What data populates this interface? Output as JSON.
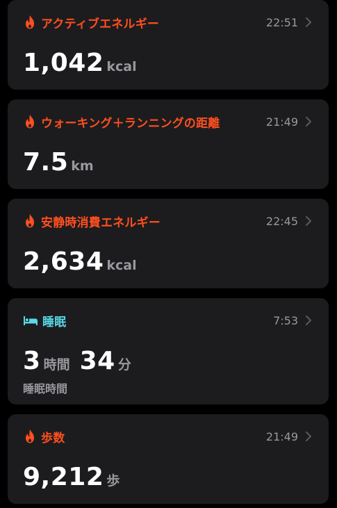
{
  "colors": {
    "accent_activity": "#ff4f1f",
    "accent_sleep": "#5ad8e6",
    "card_bg": "#1c1c1e",
    "secondary_text": "#98989e"
  },
  "cards": [
    {
      "icon": "flame-icon",
      "title": "アクティブエネルギー",
      "time": "22:51",
      "value": "1,042",
      "unit": "kcal"
    },
    {
      "icon": "flame-icon",
      "title": "ウォーキング＋ランニングの距離",
      "time": "21:49",
      "value": "7.5",
      "unit": "km"
    },
    {
      "icon": "flame-icon",
      "title": "安静時消費エネルギー",
      "time": "22:45",
      "value": "2,634",
      "unit": "kcal"
    },
    {
      "icon": "bed-icon",
      "title": "睡眠",
      "time": "7:53",
      "hours_value": "3",
      "hours_unit": "時間",
      "minutes_value": "34",
      "minutes_unit": "分",
      "sub_label": "睡眠時間"
    },
    {
      "icon": "flame-icon",
      "title": "歩数",
      "time": "21:49",
      "value": "9,212",
      "unit": "歩"
    }
  ]
}
